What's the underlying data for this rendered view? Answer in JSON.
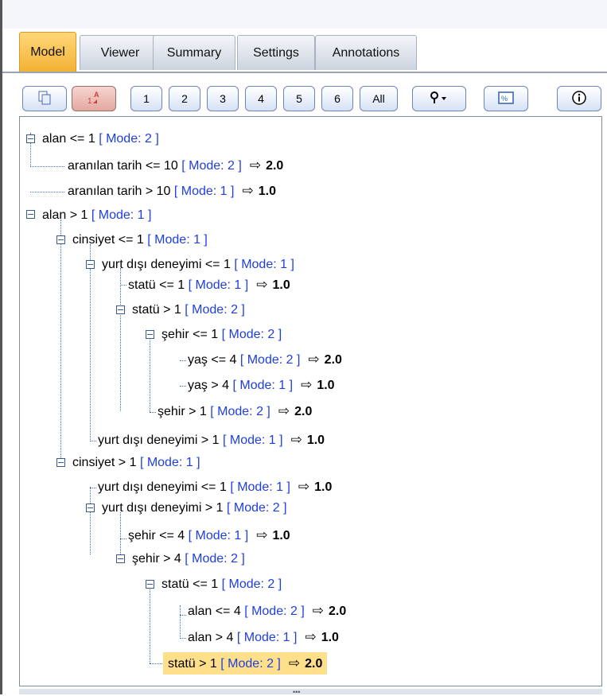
{
  "tabs": [
    {
      "label": "Model",
      "active": true
    },
    {
      "label": "Viewer",
      "active": false
    },
    {
      "label": "Summary",
      "active": false
    },
    {
      "label": "Settings",
      "active": false
    },
    {
      "label": "Annotations",
      "active": false
    }
  ],
  "toolbar": {
    "depth_buttons": [
      "1",
      "2",
      "3",
      "4",
      "5",
      "6",
      "All"
    ],
    "icons": [
      "copy-icon",
      "rule-id-icon",
      "pin-icon",
      "percent-icon",
      "info-icon"
    ]
  },
  "tree": [
    {
      "cond": "alan <= 1",
      "mode": "[ Mode: 2 ]",
      "expanded": true,
      "depth": 0
    },
    {
      "cond": "aranılan tarih <= 10",
      "mode": "[ Mode: 2 ]",
      "arrow": "⇨",
      "pred": "2.0",
      "depth": 1
    },
    {
      "cond": "aranılan tarih > 10",
      "mode": "[ Mode: 1 ]",
      "arrow": "⇨",
      "pred": "1.0",
      "depth": 1
    },
    {
      "cond": "alan > 1",
      "mode": "[ Mode: 1 ]",
      "expanded": true,
      "depth": 0
    },
    {
      "cond": "cinsiyet <= 1",
      "mode": "[ Mode: 1 ]",
      "expanded": true,
      "depth": 1
    },
    {
      "cond": "yurt dışı deneyimi <= 1",
      "mode": "[ Mode: 1 ]",
      "expanded": true,
      "depth": 2
    },
    {
      "cond": "statü <= 1",
      "mode": "[ Mode: 1 ]",
      "arrow": "⇨",
      "pred": "1.0",
      "depth": 3
    },
    {
      "cond": "statü > 1",
      "mode": "[ Mode: 2 ]",
      "expanded": true,
      "depth": 3
    },
    {
      "cond": "şehir <= 1",
      "mode": "[ Mode: 2 ]",
      "expanded": true,
      "depth": 4
    },
    {
      "cond": "yaş <= 4",
      "mode": "[ Mode: 2 ]",
      "arrow": "⇨",
      "pred": "2.0",
      "depth": 5
    },
    {
      "cond": "yaş > 4",
      "mode": "[ Mode: 1 ]",
      "arrow": "⇨",
      "pred": "1.0",
      "depth": 5
    },
    {
      "cond": "şehir > 1",
      "mode": "[ Mode: 2 ]",
      "arrow": "⇨",
      "pred": "2.0",
      "depth": 4
    },
    {
      "cond": "yurt dışı deneyimi > 1",
      "mode": "[ Mode: 1 ]",
      "arrow": "⇨",
      "pred": "1.0",
      "depth": 2
    },
    {
      "cond": "cinsiyet > 1",
      "mode": "[ Mode: 1 ]",
      "expanded": true,
      "depth": 1
    },
    {
      "cond": "yurt dışı deneyimi <= 1",
      "mode": "[ Mode: 1 ]",
      "arrow": "⇨",
      "pred": "1.0",
      "depth": 2
    },
    {
      "cond": "yurt dışı deneyimi > 1",
      "mode": "[ Mode: 2 ]",
      "expanded": true,
      "depth": 2
    },
    {
      "cond": "şehir <= 4",
      "mode": "[ Mode: 1 ]",
      "arrow": "⇨",
      "pred": "1.0",
      "depth": 3
    },
    {
      "cond": "şehir > 4",
      "mode": "[ Mode: 2 ]",
      "expanded": true,
      "depth": 3
    },
    {
      "cond": "statü <= 1",
      "mode": "[ Mode: 2 ]",
      "expanded": true,
      "depth": 4
    },
    {
      "cond": "alan <= 4",
      "mode": "[ Mode: 2 ]",
      "arrow": "⇨",
      "pred": "2.0",
      "depth": 5
    },
    {
      "cond": "alan > 4",
      "mode": "[ Mode: 1 ]",
      "arrow": "⇨",
      "pred": "1.0",
      "depth": 5
    },
    {
      "cond": "statü > 1",
      "mode": "[ Mode: 2 ]",
      "arrow": "⇨",
      "pred": "2.0",
      "depth": 4,
      "selected": true
    }
  ],
  "colors": {
    "accent": "#f3b135",
    "mode_text": "#1f3ee0",
    "selection": "#ffe08a"
  }
}
